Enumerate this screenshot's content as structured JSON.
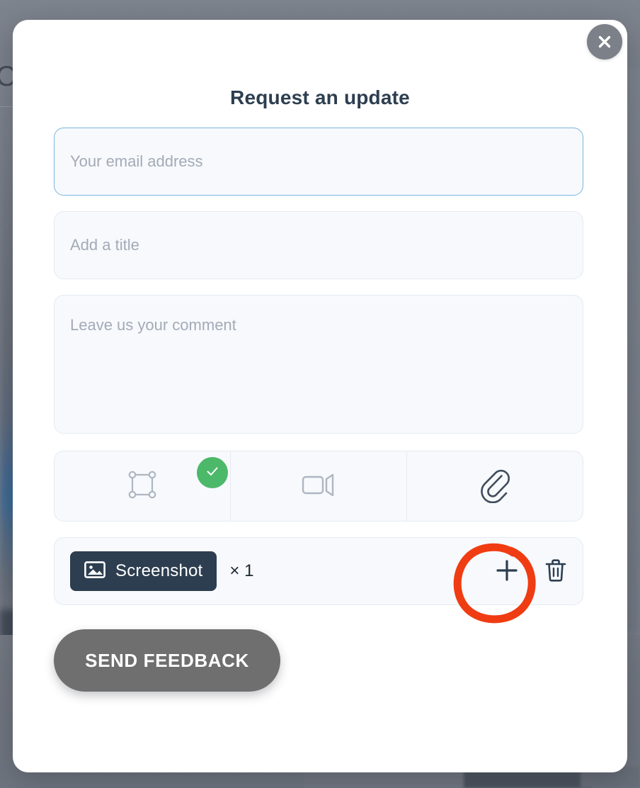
{
  "background": {
    "partial_text": "C"
  },
  "modal": {
    "title": "Request an update",
    "close_label": "×",
    "fields": {
      "email_placeholder": "Your email address",
      "email_value": "",
      "title_placeholder": "Add a title",
      "title_value": "",
      "comment_placeholder": "Leave us your comment",
      "comment_value": ""
    },
    "capture_modes": [
      {
        "name": "screenshot",
        "icon": "selection-frame-icon",
        "selected": true
      },
      {
        "name": "video",
        "icon": "video-camera-icon",
        "selected": false
      },
      {
        "name": "attachment",
        "icon": "paperclip-icon",
        "selected": false
      }
    ],
    "attachment": {
      "chip_icon": "image-icon",
      "chip_label": "Screenshot",
      "count_text": "× 1",
      "add_icon": "plus-icon",
      "delete_icon": "trash-icon"
    },
    "submit_label": "SEND FEEDBACK"
  },
  "annotation": {
    "shape": "hand-drawn-circle",
    "color": "#f03c12",
    "target": "add-attachment-button"
  },
  "colors": {
    "title": "#2d3e50",
    "focus_border": "#79b7de",
    "field_bg": "#f7f9fc",
    "chip_bg": "#2d3e50",
    "check_badge": "#4cb86a",
    "submit_bg": "#6f6f6f",
    "annotation": "#f03c12"
  }
}
